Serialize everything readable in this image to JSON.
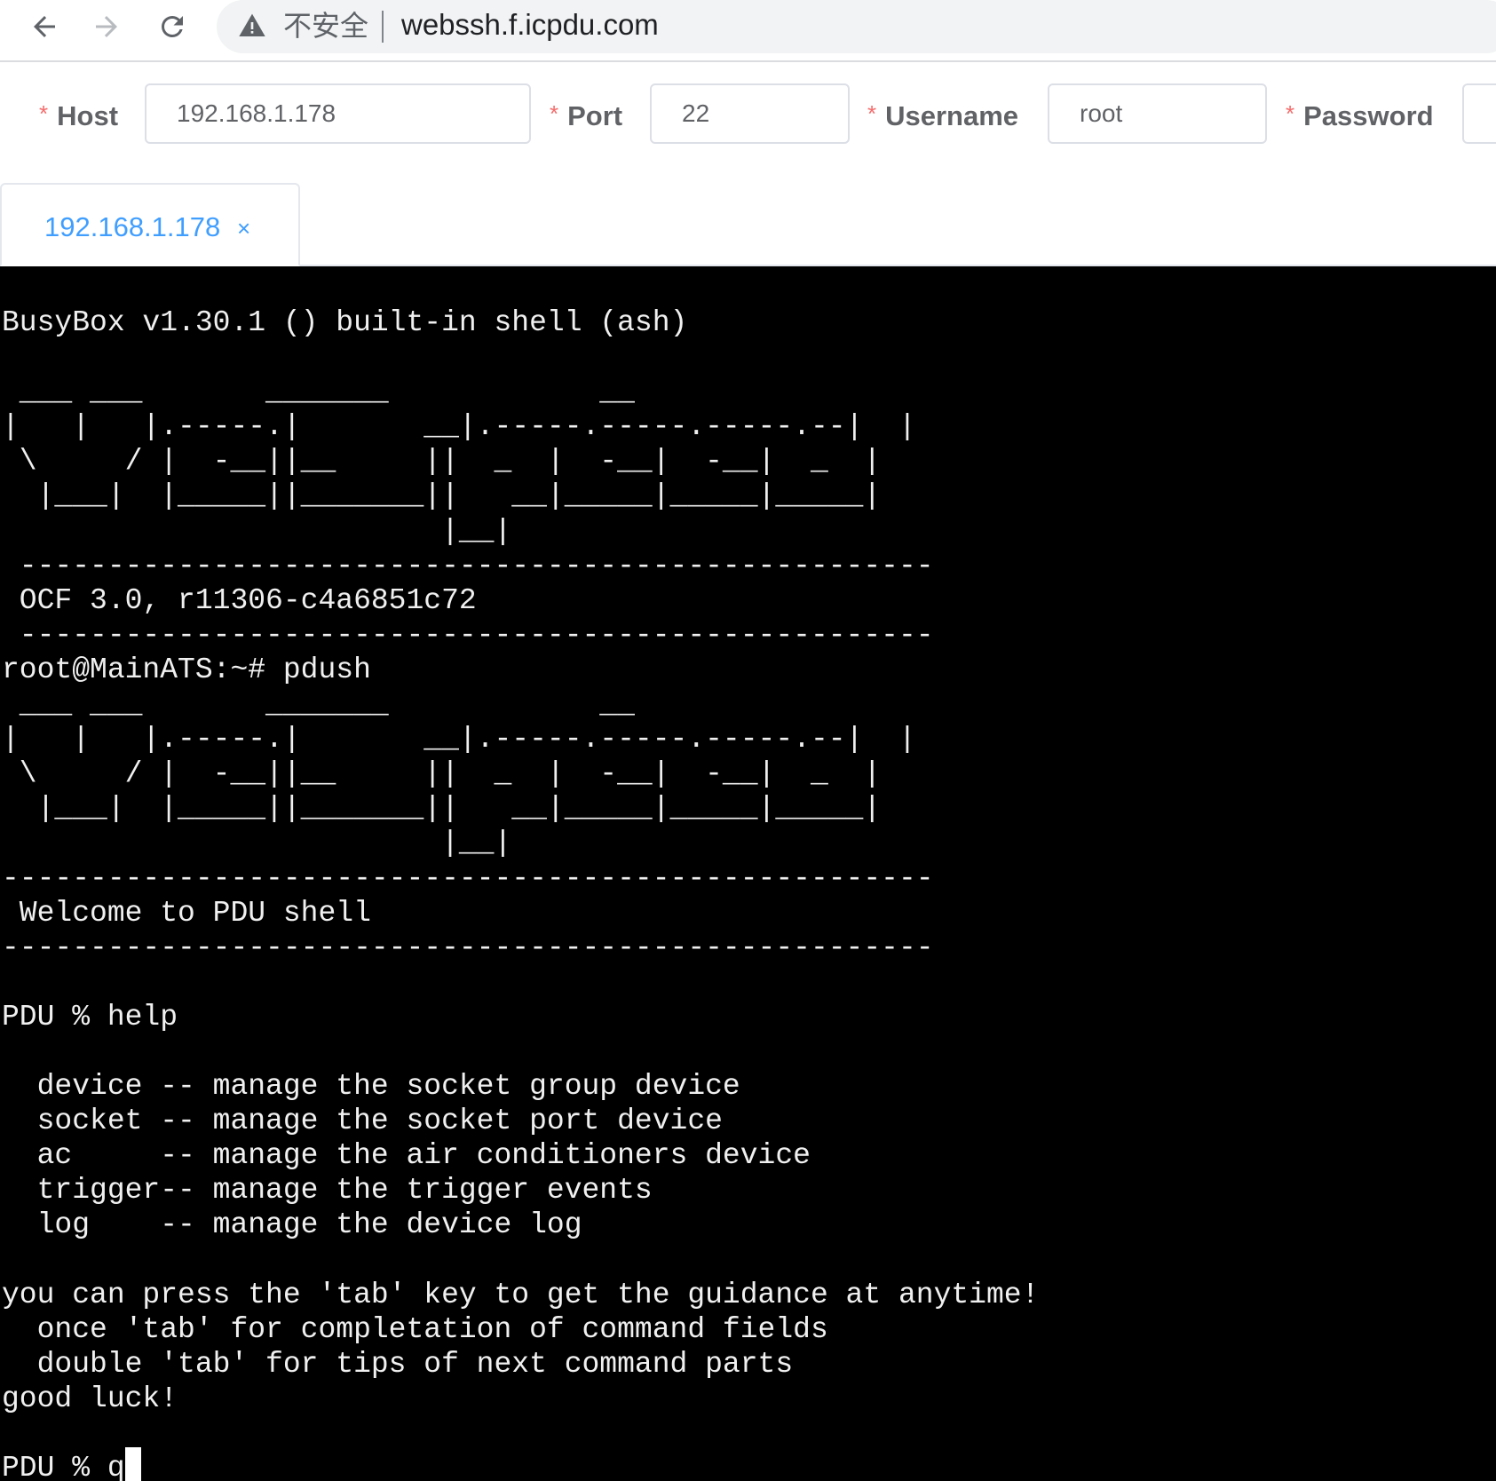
{
  "browser": {
    "insecure_label": "不安全",
    "url": "webssh.f.icpdu.com"
  },
  "form": {
    "host_label": "Host",
    "host_value": "192.168.1.178",
    "port_label": "Port",
    "port_value": "22",
    "username_label": "Username",
    "username_value": "root",
    "password_label": "Password",
    "required_mark": "*"
  },
  "tabs": [
    {
      "label": "192.168.1.178",
      "close": "×"
    }
  ],
  "terminal": {
    "output": "BusyBox v1.30.1 () built-in shell (ash)\n\n ___ ___       _______            __\n|   |   |.-----.|       __|.-----.-----.-----.--|  |\n \\     / |  -__||__     ||  _  |  -__|  -__|  _  |\n  |___|  |_____||_______||   __|_____|_____|_____|\n                         |__|\n ----------------------------------------------------\n OCF 3.0, r11306-c4a6851c72\n ----------------------------------------------------\nroot@MainATS:~# pdush\n ___ ___       _______            __\n|   |   |.-----.|       __|.-----.-----.-----.--|  |\n \\     / |  -__||__     ||  _  |  -__|  -__|  _  |\n  |___|  |_____||_______||   __|_____|_____|_____|\n                         |__|\n-----------------------------------------------------\n Welcome to PDU shell\n-----------------------------------------------------\n\nPDU % help\n\n  device -- manage the socket group device\n  socket -- manage the socket port device\n  ac     -- manage the air conditioners device\n  trigger-- manage the trigger events\n  log    -- manage the device log\n\nyou can press the 'tab' key to get the guidance at anytime!\n  once 'tab' for completation of command fields\n  double 'tab' for tips of next command parts\ngood luck!",
    "prompt": "PDU % ",
    "input": "q"
  },
  "colors": {
    "terminal_bg": "#000000",
    "terminal_fg": "#f0f0f0",
    "tab_active": "#409eff",
    "required": "#f56c6c"
  },
  "icons": {
    "back": "back-arrow-icon",
    "forward": "forward-arrow-icon",
    "reload": "reload-icon",
    "warning": "warning-triangle-icon",
    "tab_close": "close-icon"
  }
}
